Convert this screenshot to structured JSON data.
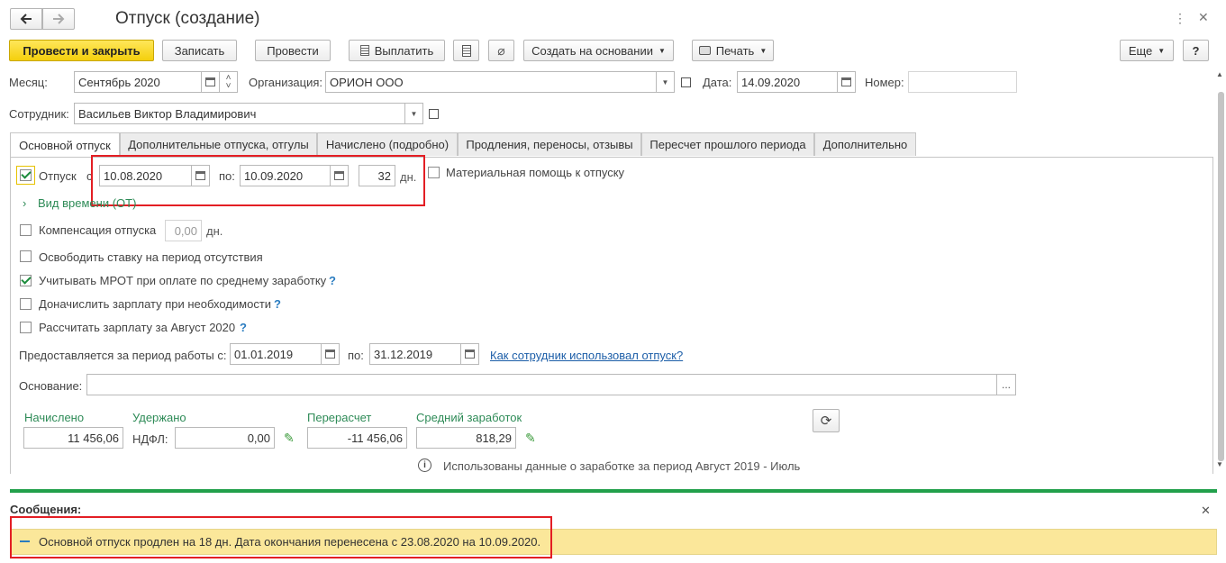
{
  "window": {
    "title": "Отпуск (создание)"
  },
  "toolbar": {
    "post_close": "Провести и закрыть",
    "save": "Записать",
    "post": "Провести",
    "pay": "Выплатить",
    "create_based": "Создать на основании",
    "print": "Печать",
    "more": "Еще",
    "help": "?"
  },
  "header": {
    "month_label": "Месяц:",
    "month_value": "Сентябрь 2020",
    "org_label": "Организация:",
    "org_value": "ОРИОН ООО",
    "date_label": "Дата:",
    "date_value": "14.09.2020",
    "number_label": "Номер:",
    "number_value": "",
    "employee_label": "Сотрудник:",
    "employee_value": "Васильев Виктор Владимирович"
  },
  "tabs": [
    "Основной отпуск",
    "Дополнительные отпуска, отгулы",
    "Начислено (подробно)",
    "Продления, переносы, отзывы",
    "Пересчет прошлого периода",
    "Дополнительно"
  ],
  "vacation": {
    "checkbox_label": "Отпуск",
    "checked": true,
    "from_label": "с",
    "from": "10.08.2020",
    "to_label": "по:",
    "to": "10.09.2020",
    "days": "32",
    "days_unit": "дн.",
    "material_help": "Материальная помощь к отпуску",
    "time_type": "Вид времени (ОТ)"
  },
  "options": {
    "compensation_label": "Компенсация отпуска",
    "compensation_value": "0,00",
    "compensation_unit": "дн.",
    "free_rate": "Освободить ставку на период отсутствия",
    "mrot": "Учитывать МРОТ при оплате по среднему заработку",
    "accrue": "Доначислить зарплату при необходимости",
    "calc_salary": "Рассчитать зарплату за Август 2020",
    "help_mark": "?"
  },
  "period": {
    "label": "Предоставляется за период работы с:",
    "from": "01.01.2019",
    "to_label": "по:",
    "to": "31.12.2019",
    "link": "Как сотрудник использовал отпуск?"
  },
  "basis": {
    "label": "Основание:",
    "value": "",
    "button": "..."
  },
  "totals": {
    "accrued_label": "Начислено",
    "accrued": "11 456,06",
    "withheld_label": "Удержано",
    "ndfl_label": "НДФЛ:",
    "ndfl": "0,00",
    "recalc_label": "Перерасчет",
    "recalc": "-11 456,06",
    "avg_label": "Средний заработок",
    "avg": "818,29",
    "info": "Использованы данные о заработке за период Август 2019 - Июль"
  },
  "messages": {
    "title": "Сообщения:",
    "text": "Основной отпуск продлен на 18 дн. Дата окончания перенесена с 23.08.2020 на 10.09.2020."
  },
  "colors": {
    "accent": "#f4cf0c",
    "green": "#2e8b57",
    "highlight": "#e31e24",
    "message_bg": "#fbe79a"
  }
}
